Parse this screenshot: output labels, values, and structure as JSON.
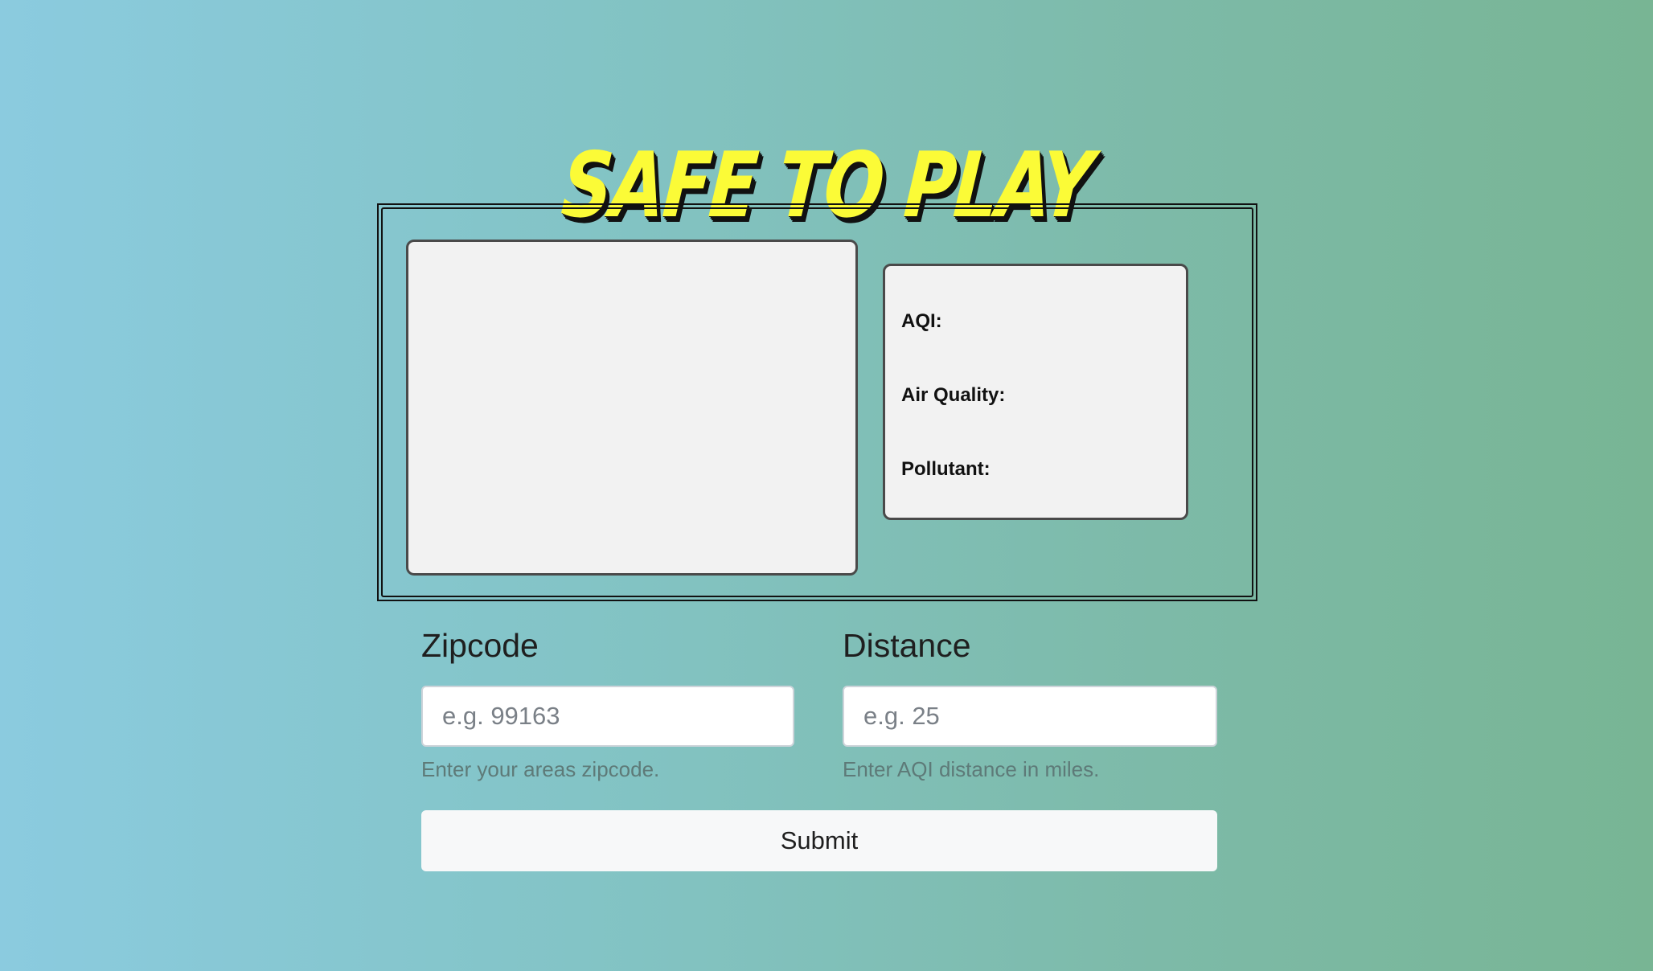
{
  "header": {
    "title": "Safe To Play"
  },
  "info": {
    "aqi_label": "AQI:",
    "air_quality_label": "Air Quality:",
    "pollutant_label": "Pollutant:"
  },
  "form": {
    "zipcode": {
      "label": "Zipcode",
      "placeholder": "e.g. 99163",
      "value": "",
      "help": "Enter your areas zipcode."
    },
    "distance": {
      "label": "Distance",
      "placeholder": "e.g. 25",
      "value": "",
      "help": "Enter AQI distance in miles."
    },
    "submit_label": "Submit"
  },
  "colors": {
    "title": "#fbfb37",
    "title_shadow": "#111111",
    "card_background": "#f2f2f2",
    "card_border": "#4a4a4a"
  }
}
